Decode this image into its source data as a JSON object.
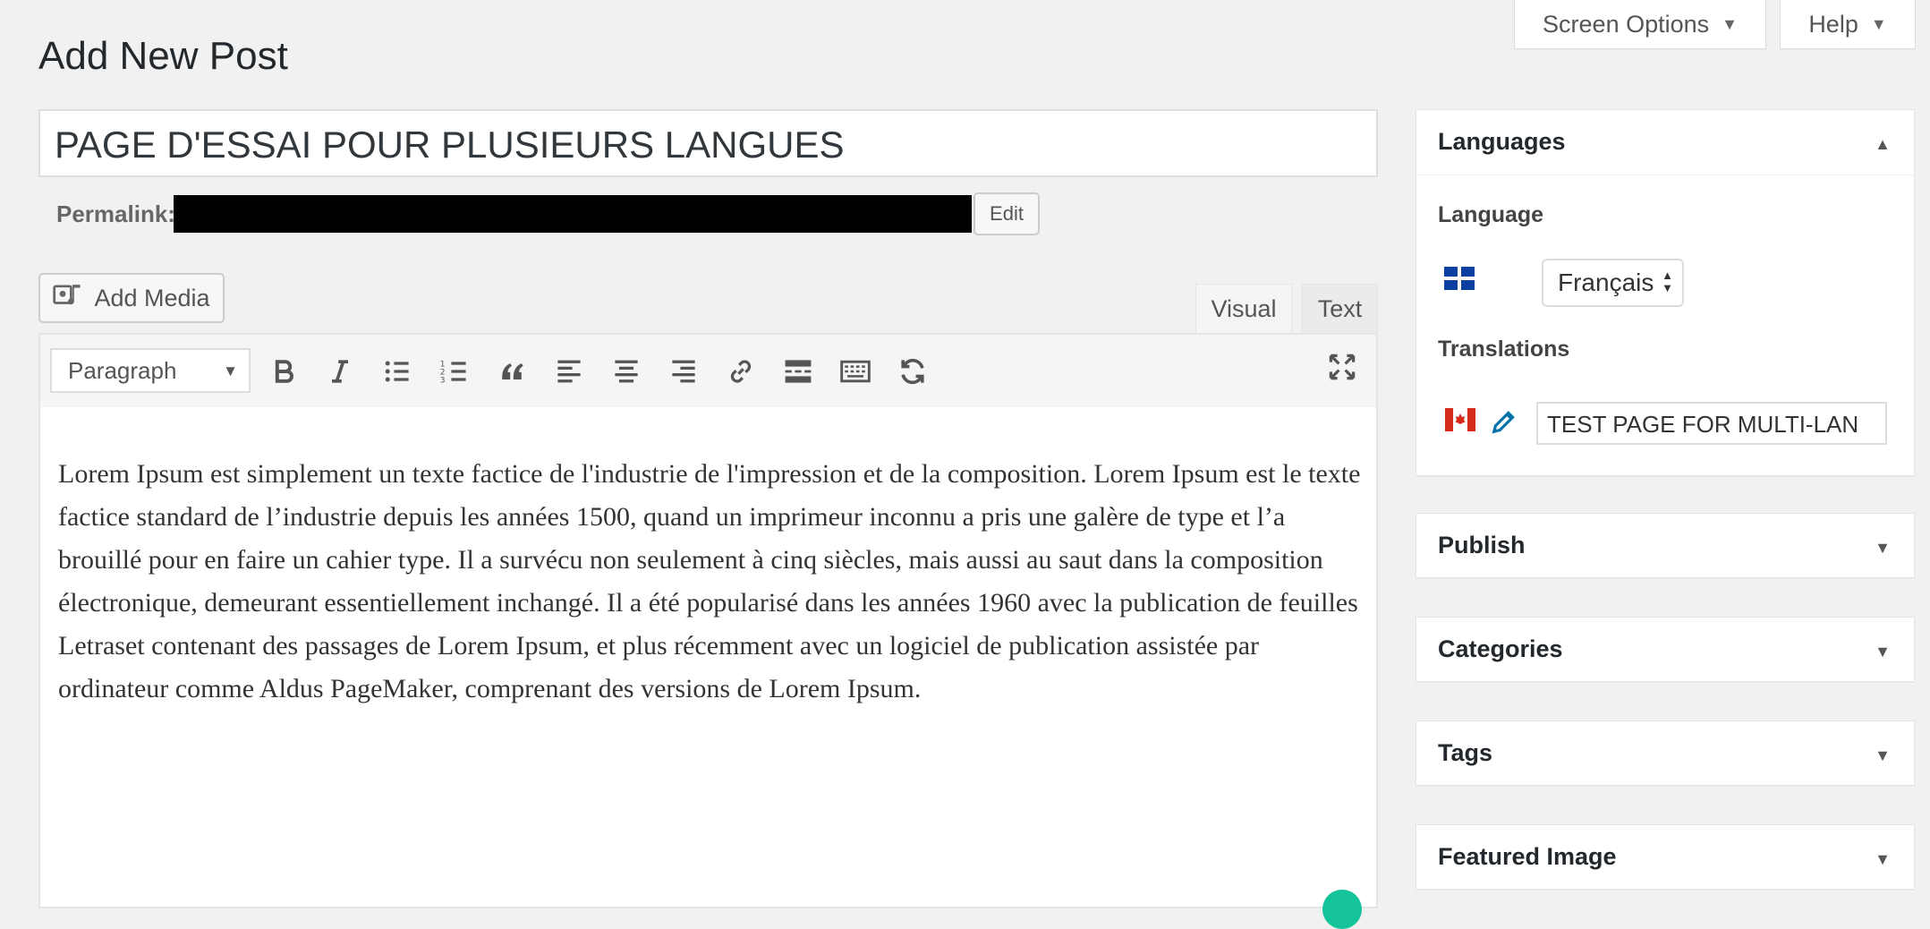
{
  "header": {
    "page_title": "Add New Post",
    "screen_options_label": "Screen Options",
    "help_label": "Help"
  },
  "post": {
    "title_value": "PAGE D'ESSAI POUR PLUSIEURS LANGUES",
    "permalink_label": "Permalink:",
    "permalink_edit_label": "Edit"
  },
  "editor": {
    "add_media_label": "Add Media",
    "tabs": {
      "visual": "Visual",
      "text": "Text"
    },
    "format_value": "Paragraph",
    "toolbar_icons": [
      "bold-icon",
      "italic-icon",
      "bullet-list-icon",
      "numbered-list-icon",
      "blockquote-icon",
      "align-left-icon",
      "align-center-icon",
      "align-right-icon",
      "link-icon",
      "read-more-icon",
      "toolbar-toggle-icon",
      "refresh-icon",
      "fullscreen-icon"
    ],
    "content": "Lorem Ipsum est simplement un texte factice de l'industrie de l'impression et de la composition. Lorem Ipsum est le texte factice standard de l’industrie depuis les années 1500, quand un imprimeur inconnu a pris une galère de type et l’a brouillé pour en faire un cahier type. Il a survécu non seulement à cinq siècles, mais aussi au saut dans la composition électronique, demeurant essentiellement inchangé. Il a été popularisé dans les années 1960 avec la publication de feuilles Letraset contenant des passages de Lorem Ipsum, et plus récemment avec un logiciel de publication assistée par ordinateur comme Aldus PageMaker, comprenant des versions de Lorem Ipsum."
  },
  "sidebar": {
    "languages": {
      "heading": "Languages",
      "language_label": "Language",
      "language_value": "Français",
      "translations_label": "Translations",
      "translation_value": "TEST PAGE FOR MULTI-LAN"
    },
    "publish": {
      "heading": "Publish"
    },
    "categories": {
      "heading": "Categories"
    },
    "tags": {
      "heading": "Tags"
    },
    "featured_image": {
      "heading": "Featured Image"
    }
  },
  "colors": {
    "background": "#f1f1f1",
    "grammarly": "#15c39a",
    "edit_pencil": "#0073aa"
  }
}
